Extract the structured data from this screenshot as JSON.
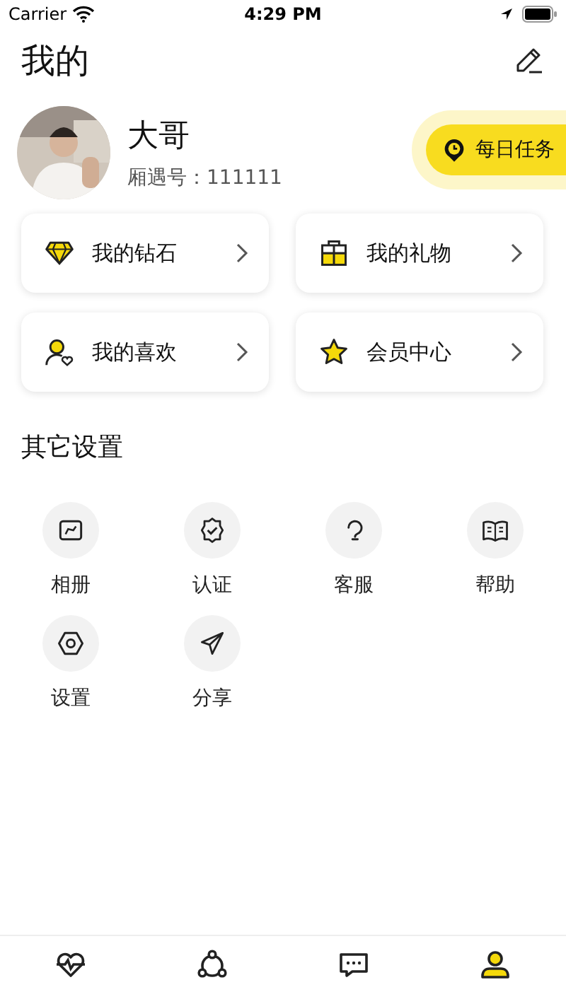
{
  "status_bar": {
    "carrier": "Carrier",
    "time": "4:29 PM"
  },
  "header": {
    "title": "我的"
  },
  "profile": {
    "name": "大哥",
    "id_label": "厢遇号：111111",
    "task_button": "每日任务"
  },
  "cards": [
    {
      "kind": "diamond",
      "label": "我的钻石"
    },
    {
      "kind": "gift",
      "label": "我的礼物"
    },
    {
      "kind": "like",
      "label": "我的喜欢"
    },
    {
      "kind": "star",
      "label": "会员中心"
    }
  ],
  "settings": {
    "title": "其它设置",
    "items": [
      {
        "kind": "album",
        "label": "相册"
      },
      {
        "kind": "verify",
        "label": "认证"
      },
      {
        "kind": "service",
        "label": "客服"
      },
      {
        "kind": "help",
        "label": "帮助"
      },
      {
        "kind": "settings",
        "label": "设置"
      },
      {
        "kind": "share",
        "label": "分享"
      }
    ]
  },
  "tab_bar": [
    {
      "kind": "heart",
      "selected": false
    },
    {
      "kind": "circle",
      "selected": false
    },
    {
      "kind": "chat",
      "selected": false
    },
    {
      "kind": "profile",
      "selected": true
    }
  ]
}
